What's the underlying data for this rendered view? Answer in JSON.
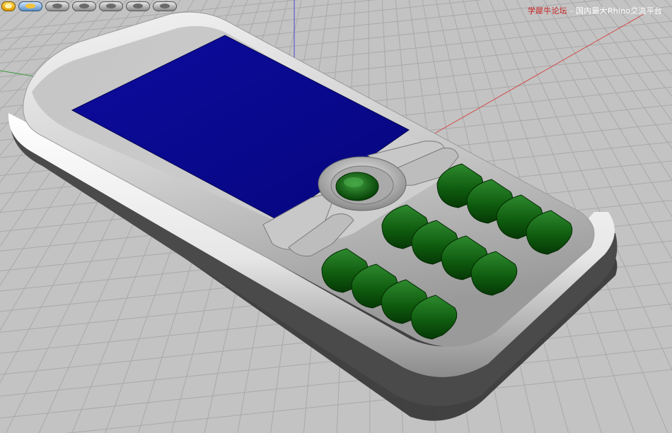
{
  "watermark": {
    "site": "学犀牛论坛",
    "separator": "-",
    "tagline": "国内最大Rhino交流平台"
  },
  "toolbar": {
    "icons": [
      "smiley-icon",
      "globe-icon",
      "material-ball-icon",
      "material-ball-icon",
      "material-ball-icon",
      "material-ball-icon",
      "material-ball-icon"
    ]
  },
  "viewport": {
    "background_color": "#c3c3c3",
    "grid_color": "#a9a9a9",
    "x_axis_color": "#d24a4a",
    "y_axis_color": "#3a9a3a",
    "z_axis_color": "#4a4ad2"
  },
  "model": {
    "screen_color": "#0a0a96",
    "key_color": "#0e5a0e",
    "body_color": "#d8d8d8"
  }
}
